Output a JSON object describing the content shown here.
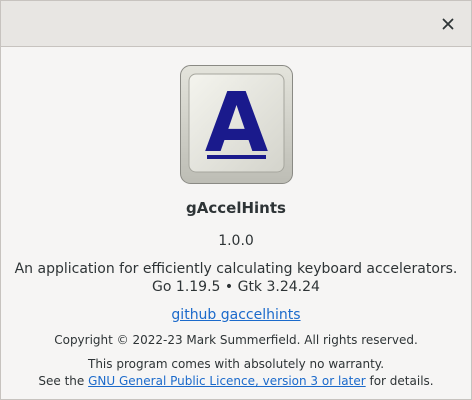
{
  "dialog": {
    "close_icon": "close-icon",
    "logo_letter": "A",
    "app_name": "gAccelHints",
    "version": "1.0.0",
    "comment_line1": "An application for efficiently calculating keyboard accelerators.",
    "comment_line2": "Go 1.19.5 • Gtk 3.24.24",
    "website_label": "github gaccelhints",
    "copyright": "Copyright © 2022-23 Mark Summerfield. All rights reserved.",
    "warranty_line1": "This program comes with absolutely no warranty.",
    "warranty_line2_prefix": "See the ",
    "license_link": "GNU General Public Licence, version 3 or later",
    "warranty_line2_suffix": " for details."
  },
  "colors": {
    "link": "#1b6acb",
    "logo_letter": "#1a1a8c",
    "headerbar": "#e8e6e3",
    "background": "#f6f5f4"
  }
}
